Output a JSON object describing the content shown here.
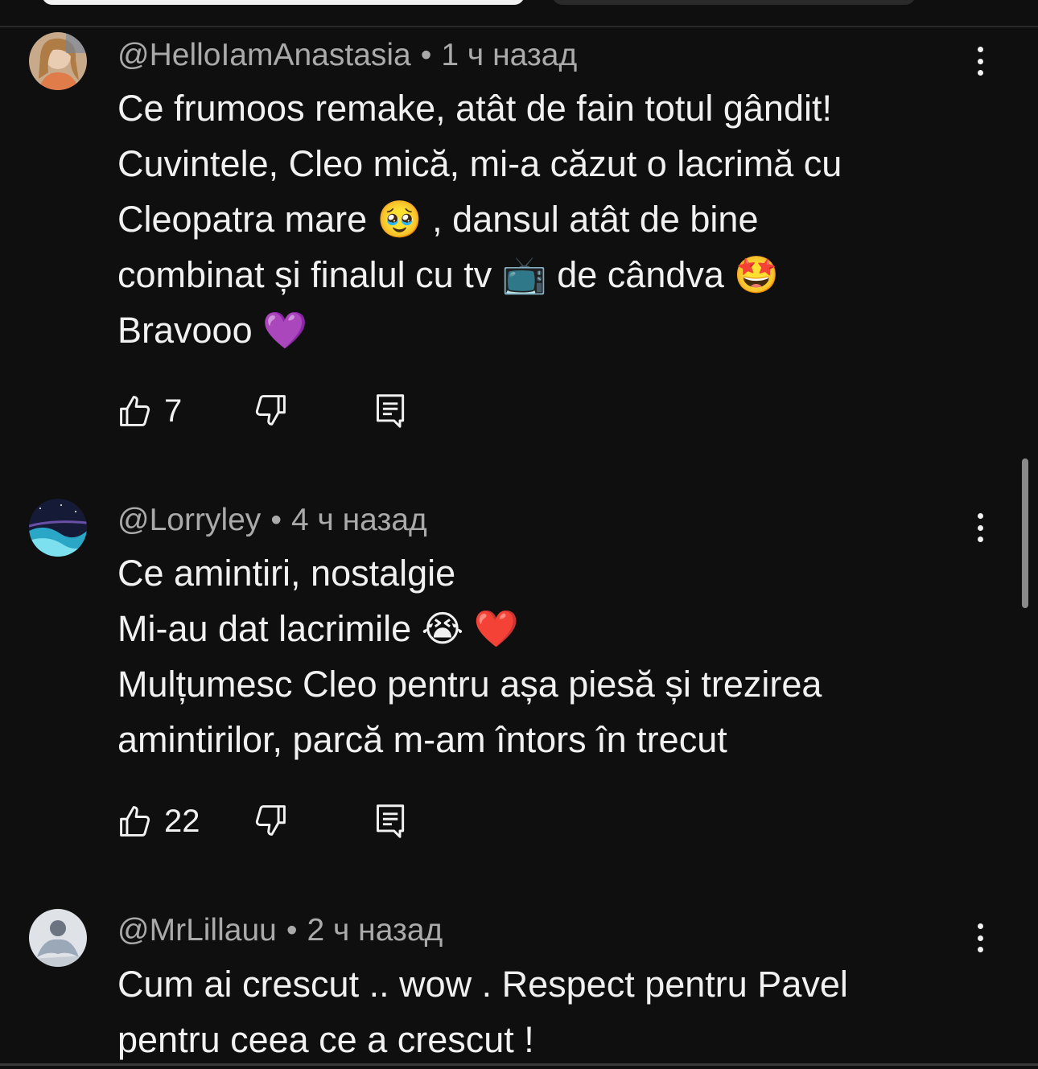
{
  "comments": [
    {
      "author": "@HelloIamAnastasia",
      "separator": "•",
      "time": "1 ч назад",
      "lines": [
        "Ce frumoos remake, atât de fain totul gândit!",
        "Cuvintele, Cleo mică, mi-a căzut o lacrimă cu",
        "Cleopatra mare 🥹 , dansul atât de bine",
        "combinat și finalul cu tv 📺 de cândva 🤩",
        "Bravooo 💜"
      ],
      "likes": "7",
      "avatar_colors": [
        "#d9c1a6",
        "#a6784f",
        "#e8d9c7"
      ]
    },
    {
      "author": "@Lorryley",
      "separator": "•",
      "time": "4 ч назад",
      "lines": [
        "Ce amintiri, nostalgie",
        "Mi-au dat lacrimile 😭 ❤️",
        "Mulțumesc Cleo pentru așa piesă și trezirea",
        "amintirilor, parcă m-am întors în trecut"
      ],
      "likes": "22",
      "avatar_colors": [
        "#1b2140",
        "#3fa9c9",
        "#0b0f22"
      ]
    },
    {
      "author": "@MrLillauu",
      "separator": "•",
      "time": "2 ч назад",
      "lines": [
        "Cum ai crescut .. wow . Respect pentru Pavel",
        "pentru ceea ce a crescut !"
      ],
      "avatar_colors": [
        "#c9ced6",
        "#8fa3b8",
        "#e7eaee"
      ]
    }
  ],
  "icons": {
    "like": "thumbs-up-icon",
    "dislike": "thumbs-down-icon",
    "reply": "reply-icon",
    "more": "more-vertical-icon"
  },
  "colors": {
    "background": "#0f0f0f",
    "text": "#f1f1f1",
    "meta": "#aaaaaa"
  }
}
